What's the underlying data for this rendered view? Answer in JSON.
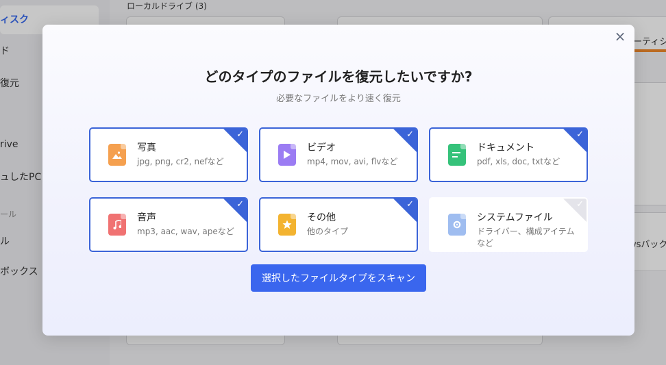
{
  "background": {
    "sidebar_items": [
      {
        "label": "ィスク",
        "active": true
      },
      {
        "label": "ド"
      },
      {
        "label": "復元"
      },
      {
        "label": "rive"
      },
      {
        "label": "ュしたPC"
      },
      {
        "label": "ール",
        "group": true
      },
      {
        "label": "ル"
      },
      {
        "label": "ボックス"
      }
    ],
    "main_title": "ローカルドライブ (3)",
    "right_text_1": "ーティシ",
    "right_text_2": "wsバック"
  },
  "modal": {
    "close_icon": "×",
    "title": "どのタイプのファイルを復元したいですか?",
    "subtitle": "必要なファイルをより速く復元",
    "cards": [
      {
        "name": "写真",
        "desc": "jpg, png, cr2, nefなど",
        "icon": "image-file-icon",
        "color": "#f5a04f",
        "selected": true
      },
      {
        "name": "ビデオ",
        "desc": "mp4, mov, avi, flvなど",
        "icon": "video-file-icon",
        "color": "#9b7cf3",
        "selected": true
      },
      {
        "name": "ドキュメント",
        "desc": "pdf, xls, doc, txtなど",
        "icon": "document-file-icon",
        "color": "#35c27a",
        "selected": true
      },
      {
        "name": "音声",
        "desc": "mp3, aac, wav, apeなど",
        "icon": "audio-file-icon",
        "color": "#f07272",
        "selected": true
      },
      {
        "name": "その他",
        "desc": "他のタイプ",
        "icon": "other-file-icon",
        "color": "#f3b330",
        "selected": true
      },
      {
        "name": "システムファイル",
        "desc": "ドライバー、構成アイテムなど",
        "icon": "system-file-icon",
        "color": "#9fbdf0",
        "selected": false
      }
    ],
    "scan_button": "選択したファイルタイプをスキャン",
    "check_glyph": "✓"
  }
}
